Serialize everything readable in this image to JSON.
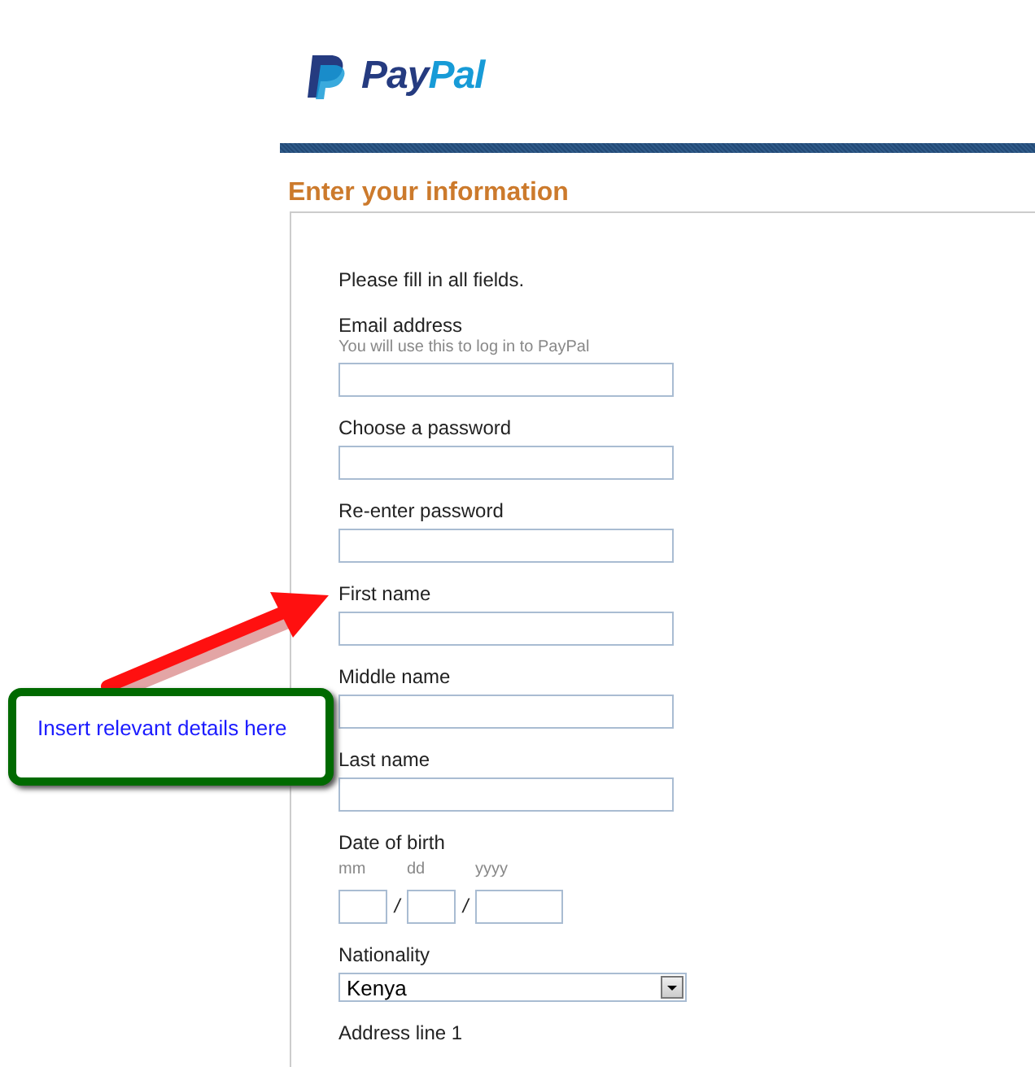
{
  "logo": {
    "parts": [
      "Pay",
      "Pal"
    ]
  },
  "heading": "Enter your information",
  "intro": "Please fill in all fields.",
  "fields": [
    {
      "kind": "text",
      "label": "Email address",
      "hint": "You will use this to log in to PayPal"
    },
    {
      "kind": "text",
      "label": "Choose a password"
    },
    {
      "kind": "text",
      "label": "Re-enter password"
    },
    {
      "kind": "text",
      "label": "First name"
    },
    {
      "kind": "text",
      "label": "Middle name"
    },
    {
      "kind": "text",
      "label": "Last name"
    },
    {
      "kind": "date",
      "label": "Date of birth",
      "parts": [
        {
          "placeholder": "mm"
        },
        {
          "placeholder": "dd"
        },
        {
          "placeholder": "yyyy"
        }
      ],
      "separators": [
        "/",
        "/"
      ]
    },
    {
      "kind": "select",
      "label": "Nationality",
      "value": "Kenya"
    },
    {
      "kind": "cut",
      "label": "Address line 1"
    }
  ],
  "callout": {
    "text": "Insert relevant details here"
  }
}
